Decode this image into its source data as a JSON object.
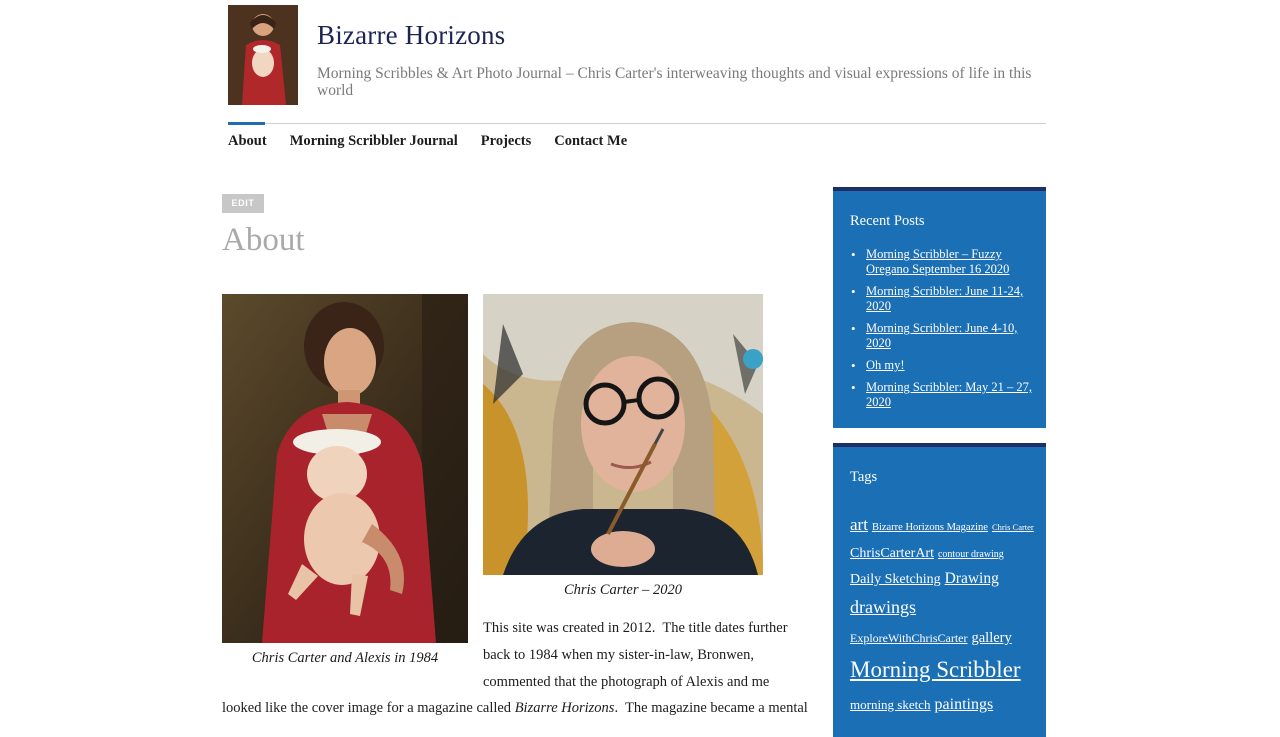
{
  "site": {
    "title": "Bizarre Horizons",
    "description": "Morning Scribbles & Art Photo Journal – Chris Carter's interweaving thoughts and visual expressions of life in this world"
  },
  "nav": {
    "items": [
      "About",
      "Morning Scribbler Journal",
      "Projects",
      "Contact Me"
    ],
    "active": "About"
  },
  "main": {
    "edit_label": "EDIT",
    "page_title": "About",
    "caption_1": "Chris Carter and Alexis in 1984",
    "caption_2": "Chris Carter – 2020",
    "paragraph_lines": [
      "This site was created in 2012.  The title dates further",
      "back to 1984 when my sister-in-law, Bronwen,",
      "commented that the photograph of Alexis and me"
    ],
    "last_line_before": "looked like the cover image for a magazine called ",
    "last_line_italic": "Bizarre Horizons",
    "last_line_after": ".  The magazine became a mental"
  },
  "sidebar": {
    "recent_title": "Recent Posts",
    "recent_posts": [
      "Morning Scribbler – Fuzzy Oregano September 16 2020",
      "Morning Scribbler: June 11-24, 2020",
      "Morning Scribbler: June 4-10, 2020",
      "Oh my!",
      "Morning Scribbler: May 21 – 27, 2020"
    ],
    "tags_title": "Tags",
    "tags": {
      "art": "art",
      "bizarre_horizons_magazine": "Bizarre Horizons Magazine",
      "chris_carter": "Chris Carter",
      "chriscarterart": "ChrisCarterArt",
      "contour_drawing": "contour drawing",
      "daily_sketching": "Daily Sketching",
      "drawing": "Drawing",
      "drawings": "drawings",
      "explorewithchriscarter": "ExploreWithChrisCarter",
      "gallery": "gallery",
      "morning_scribbler": "Morning Scribbler",
      "morning_sketch": "morning sketch",
      "paintings": "paintings"
    }
  },
  "colors": {
    "accent": "#1f6db3",
    "widget_bg": "#1b6fb5",
    "widget_border": "#1d2f66",
    "title": "#1d2454"
  }
}
